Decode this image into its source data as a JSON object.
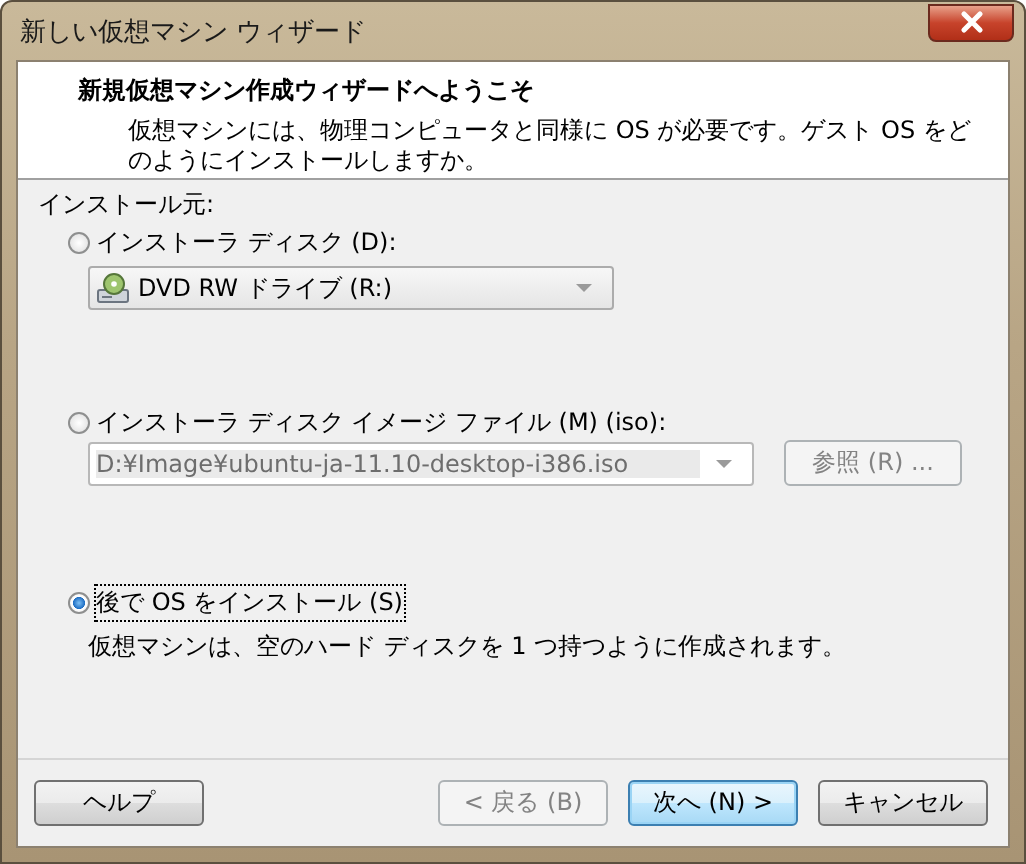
{
  "window": {
    "title": "新しい仮想マシン ウィザード"
  },
  "header": {
    "title": "新規仮想マシン作成ウィザードへようこそ",
    "description": "仮想マシンには、物理コンピュータと同様に OS が必要です。ゲスト OS をどのようにインストールしますか。"
  },
  "source_label": "インストール元:",
  "options": [
    {
      "kind": "disc",
      "label": "インストーラ ディスク (D):",
      "selected": false,
      "combo": {
        "value": "DVD RW ドライブ (R:)",
        "disabled": false
      }
    },
    {
      "kind": "iso",
      "label": "インストーラ ディスク イメージ ファイル (M) (iso):",
      "selected": false,
      "combo": {
        "value": "D:¥Image¥ubuntu-ja-11.10-desktop-i386.iso",
        "disabled": true
      },
      "browse": {
        "label": "参照 (R) ...",
        "disabled": true
      }
    },
    {
      "kind": "later",
      "label": "後で OS をインストール (S)",
      "selected": true,
      "note": "仮想マシンは、空のハード ディスクを 1 つ持つように作成されます。"
    }
  ],
  "buttons": [
    {
      "label": "ヘルプ",
      "disabled": false,
      "default": false
    },
    {
      "label": "< 戻る (B)",
      "disabled": true,
      "default": false
    },
    {
      "label": "次へ (N) >",
      "disabled": false,
      "default": true
    },
    {
      "label": "キャンセル",
      "disabled": false,
      "default": false
    }
  ]
}
